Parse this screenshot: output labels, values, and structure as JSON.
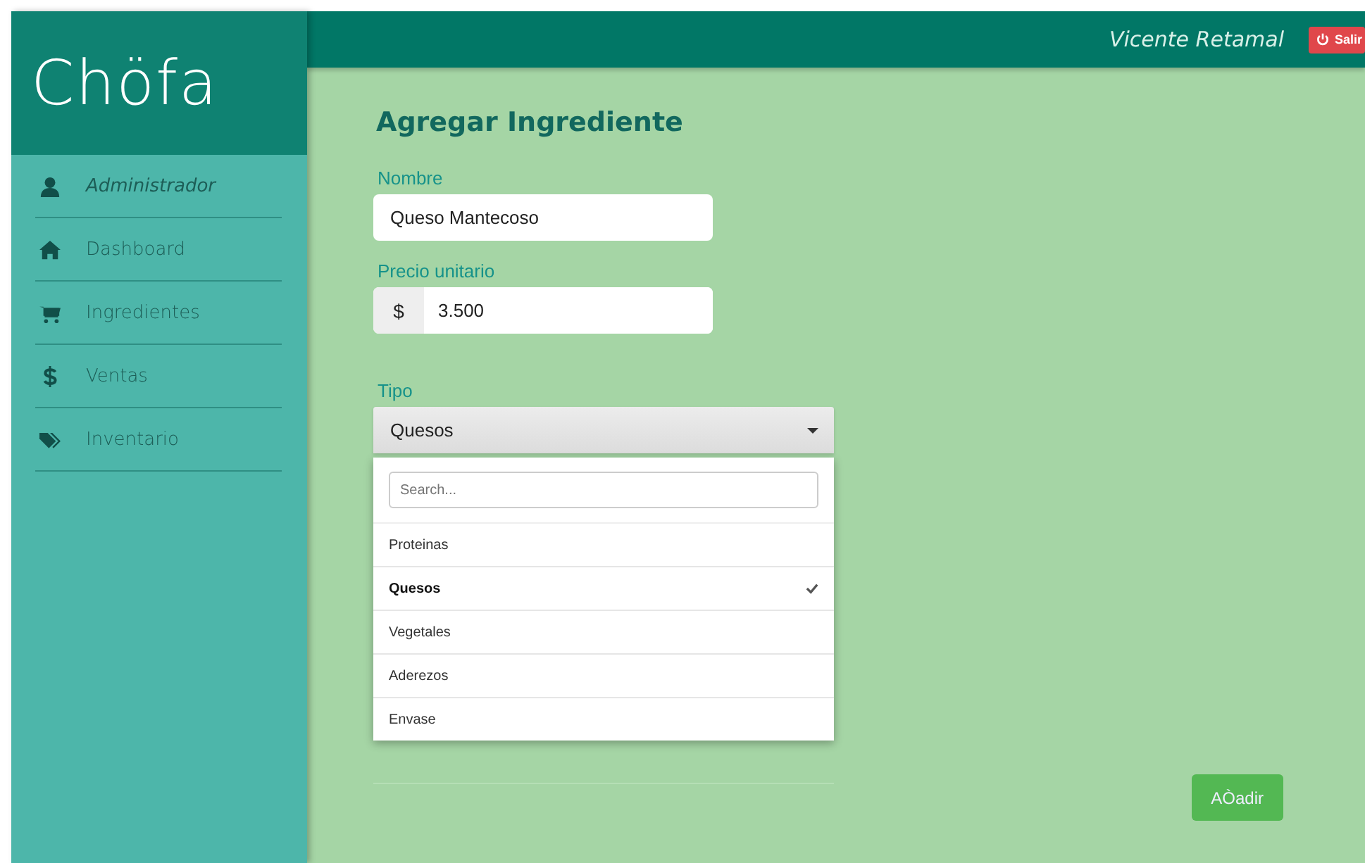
{
  "logo": "Chöfa",
  "sidebar": {
    "items": [
      {
        "label": "Administrador",
        "kind": "user",
        "selected": false
      },
      {
        "label": "Dashboard",
        "kind": "home",
        "selected": false
      },
      {
        "label": "Ingredientes",
        "kind": "cart",
        "selected": false
      },
      {
        "label": "Ventas",
        "kind": "dollar",
        "selected": false
      },
      {
        "label": "Inventario",
        "kind": "tags",
        "selected": false
      }
    ]
  },
  "header": {
    "user": "Vicente Retamal",
    "logout": "Salir"
  },
  "form": {
    "title": "Agregar Ingrediente",
    "name": {
      "label": "Nombre",
      "value": "Queso Mantecoso"
    },
    "price": {
      "label": "Precio unitario",
      "prefix": "$",
      "value": "3.500"
    },
    "type": {
      "label": "Tipo",
      "value": "Quesos",
      "expanded": true,
      "search_placeholder": "Search...",
      "options": [
        {
          "label": "Proteinas",
          "selected": false
        },
        {
          "label": "Quesos",
          "selected": true
        },
        {
          "label": "Vegetales",
          "selected": false
        },
        {
          "label": "Aderezos",
          "selected": false
        },
        {
          "label": "Envase",
          "selected": false
        }
      ]
    },
    "submit": "AÒadir"
  }
}
